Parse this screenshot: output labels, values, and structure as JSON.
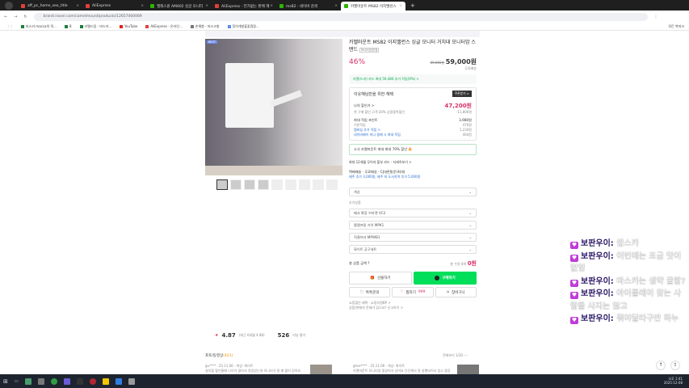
{
  "browser": {
    "tabs": [
      {
        "label": "aff_pc_home_seo_title",
        "color": "#e0413a"
      },
      {
        "label": "AliExpress",
        "color": "#e0413a"
      },
      {
        "label": "엘레스원 AM402 싱글 모니터",
        "color": "#2db400"
      },
      {
        "label": "AliExpress - 언가없는 판매 제",
        "color": "#e0413a"
      },
      {
        "label": "ms82 : 네이버 검색",
        "color": "#2db400"
      },
      {
        "label": "카멜마운트 MS82 이지밸런스",
        "color": "#2db400",
        "active": true
      }
    ],
    "url": "brand.naver.com/camelmount/products/12657400069",
    "bookmarks": [
      "마스카 macca의 직...",
      "8",
      "카멜드럽 - 마스카...",
      "YouTube",
      "AliExpress - 온라인...",
      "손해봄 - 마스크총",
      "찾아개발불꽃캠핑..."
    ],
    "all_bookmarks": "모든 북마크"
  },
  "product": {
    "badge": "BEST",
    "title": "카멜마운트 MS82 이지밸런스 싱글 모니터 거치대 모니터암 스탠드",
    "tag": "모니터암/받침",
    "discount": "46%",
    "original_price": "89,000원",
    "price": "59,000원",
    "shipping": "무료배송",
    "card_promo": "카멜(드러) 카드 최대 59,480 추가 적립(9%) >",
    "benefit_title": "이웃혜님만을 위한 혜택",
    "coupon_btn": "쿠폰받기 >",
    "my_price_label": "나의 할인가 >",
    "my_price": "47,200원",
    "my_price_note": "첫 구매 할인 고객 20% 상품중복할인",
    "my_price_sub": "-11,800원",
    "points_label": "최대 적립 포인트",
    "points": "3,980원",
    "base_points": "기본적립",
    "base_points_v": "470원",
    "plus_points": "멤버십 추가 적립 >",
    "plus_points_v": "1,234원",
    "card_points": "네이버페이 머니 결제 시 최대 적립",
    "card_points_v": "464원",
    "store_notice": "소식 카멜마운트 최대 최대 70% 할인 🔥",
    "installment": "최대 12개월 무이자 할부 카드 · 자세히보기 >",
    "delivery": "택배배송 · 무료배송 · CJ대한통운(최대)",
    "delivery_note": "제주 추가 3,000원, 제주 외 도서지역 추가 5,000원",
    "color_select": "색상",
    "addon_label": "추가상품",
    "addons": [
      "베사 확장 브라켓 VC2",
      "클램프용 거치 MPK1",
      "직결브라 MPWB1",
      "화이트 공구세트"
    ],
    "total_label": "총 상품 금액 ?",
    "total_qty": "총 수량 0개",
    "total": "0원",
    "gift": "선물하기",
    "buy": "구매하기",
    "talk": "톡톡문의",
    "zzim": "찜하기",
    "zzim_count": "999",
    "cart": "장바구니",
    "notice1": "쇼핑할인 혜택 · 쇼핑지원BP >",
    "notice2": "상품/판매자 문제가 있나요? 신고하기 >",
    "rating": "4.87",
    "rating_note": "(최근 6개월 4.86)",
    "reviews": "526",
    "reviews_label": "리뷰 평가",
    "review_section": "포토/동영상",
    "review_count": "(421)",
    "review_sort": "전체보기",
    "review_page": "1/30",
    "review1_meta": "gu**** · 25.11.06 · 색상: 화이트",
    "review1_text": "설치할 할인줄때 나이가 많아서 걸었었는데 모니터가 잘 꽤 붙어 있어요",
    "review2_meta": "ghse**** · 25.11.06 · 색상: 화이트",
    "review2_text": "카멜마운트 모니터암 좋았어서 샀어요 단단해서 잘 실행되어서 있고 좋음"
  },
  "chat": [
    {
      "name": "보판우이:",
      "msg": "쌉스카"
    },
    {
      "name": "보판우이:",
      "msg": "이번에는 조금 맛이없엉"
    },
    {
      "name": "보판우이:",
      "msg": "마스카는 생약 꿀함?"
    },
    {
      "name": "보판우이:",
      "msg": "아이플레이 찾는 사람들 사지는 않고"
    },
    {
      "name": "보판우이:",
      "msg": "뭐야달라구만 하누"
    }
  ],
  "taskbar": {
    "time": "오후 1:41",
    "date": "2025-12-08"
  }
}
